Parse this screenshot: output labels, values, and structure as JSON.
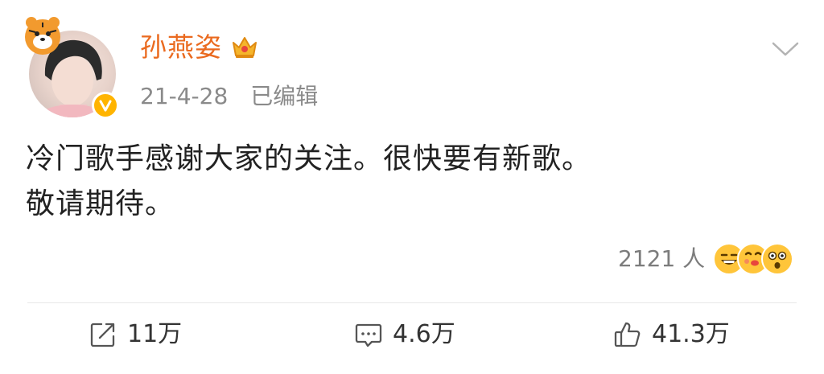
{
  "post": {
    "username": "孙燕姿",
    "date": "21-4-28",
    "edited_label": "已编辑",
    "content_line1": "冷门歌手感谢大家的关注。很快要有新歌。",
    "content_line2": "敬请期待。",
    "reaction_count": "2121 人",
    "icons": {
      "avatar": "avatar",
      "tiger": "tiger-sticker-icon",
      "verified": "verified-badge-icon",
      "crown": "crown-icon",
      "menu": "chevron-down-icon",
      "reactions": [
        "laugh-emoji-icon",
        "kiss-emoji-icon",
        "surprised-emoji-icon"
      ]
    }
  },
  "actions": {
    "repost_count": "11万",
    "comment_count": "4.6万",
    "like_count": "41.3万"
  },
  "colors": {
    "username": "#ea6a1f",
    "verified_badge": "#ffb400",
    "muted_text": "#8a8a8a"
  }
}
